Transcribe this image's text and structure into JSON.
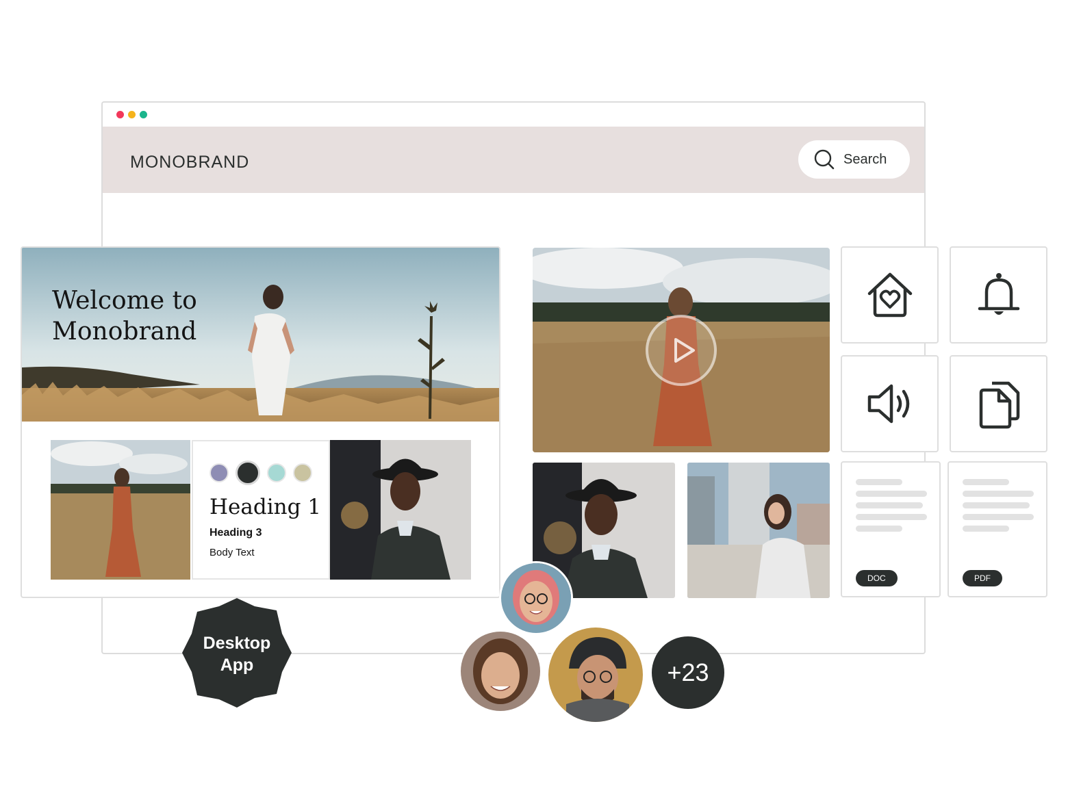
{
  "window": {
    "controls": [
      {
        "name": "close",
        "color": "#f2385b"
      },
      {
        "name": "minimize",
        "color": "#f5b31b"
      },
      {
        "name": "maximize",
        "color": "#1bb58c"
      }
    ]
  },
  "header": {
    "brand": "MONOBRAND",
    "search_label": "Search",
    "search_icon": "search-icon",
    "background": "#e7dfde"
  },
  "welcome_card": {
    "hero_title_line1": "Welcome to",
    "hero_title_line2": "Monobrand",
    "style_guide": {
      "swatches": [
        "#8e8db4",
        "#2b2f2e",
        "#a6d9d4",
        "#c9c3a0"
      ],
      "heading1": "Heading 1",
      "heading3": "Heading 3",
      "body": "Body Text"
    }
  },
  "icons": [
    "home-heart-icon",
    "bell-icon",
    "speaker-icon",
    "documents-icon"
  ],
  "files": [
    {
      "type": "DOC"
    },
    {
      "type": "PDF"
    }
  ],
  "collaborators": {
    "more_count": "+23"
  },
  "badge": {
    "line1": "Desktop",
    "line2": "App"
  },
  "colors": {
    "dark": "#2b2f2e",
    "border": "#dedede"
  }
}
